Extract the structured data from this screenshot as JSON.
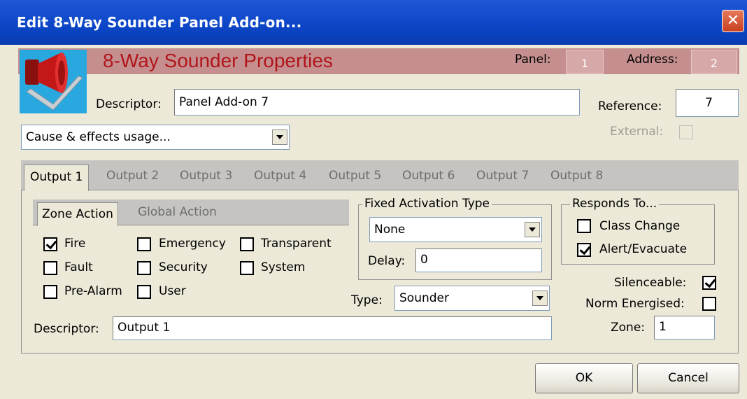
{
  "window": {
    "title": "Edit 8-Way Sounder Panel Add-on..."
  },
  "colors": {
    "titlebar": "#0b45c6",
    "banner": "#c68f8f",
    "heading": "#b0151a",
    "icon_bg": "#29a8e0"
  },
  "header": {
    "heading": "8-Way Sounder Properties",
    "panel_label": "Panel:",
    "panel_value": "1",
    "address_label": "Address:",
    "address_value": "2",
    "icon": "sounder-icon"
  },
  "descriptor": {
    "label": "Descriptor:",
    "value": "Panel Add-on 7"
  },
  "reference": {
    "label": "Reference:",
    "value": "7"
  },
  "cause_effects": {
    "value": "Cause & effects usage..."
  },
  "external": {
    "label": "External:"
  },
  "tabs": [
    {
      "label": "Output 1"
    },
    {
      "label": "Output 2"
    },
    {
      "label": "Output 3"
    },
    {
      "label": "Output 4"
    },
    {
      "label": "Output 5"
    },
    {
      "label": "Output 6"
    },
    {
      "label": "Output 7"
    },
    {
      "label": "Output 8"
    }
  ],
  "subtabs": [
    {
      "label": "Zone Action"
    },
    {
      "label": "Global Action"
    }
  ],
  "zone_checks": [
    {
      "label": "Fire",
      "checked": true
    },
    {
      "label": "Emergency",
      "checked": false
    },
    {
      "label": "Transparent",
      "checked": false
    },
    {
      "label": "Fault",
      "checked": false
    },
    {
      "label": "Security",
      "checked": false
    },
    {
      "label": "System",
      "checked": false
    },
    {
      "label": "Pre-Alarm",
      "checked": false
    },
    {
      "label": "User",
      "checked": false
    }
  ],
  "fixed_activation": {
    "title": "Fixed Activation Type",
    "value": "None",
    "delay_label": "Delay:",
    "delay_value": "0"
  },
  "type": {
    "label": "Type:",
    "value": "Sounder"
  },
  "responds_to": {
    "title": "Responds To...",
    "items": [
      {
        "label": "Class Change",
        "checked": false
      },
      {
        "label": "Alert/Evacuate",
        "checked": true
      }
    ]
  },
  "options": {
    "silenceable_label": "Silenceable:",
    "silenceable": true,
    "norm_energised_label": "Norm Energised:",
    "norm_energised": false,
    "zone_label": "Zone:",
    "zone_value": "1"
  },
  "output_descriptor": {
    "label": "Descriptor:",
    "value": "Output 1"
  },
  "buttons": {
    "ok": "OK",
    "cancel": "Cancel"
  }
}
